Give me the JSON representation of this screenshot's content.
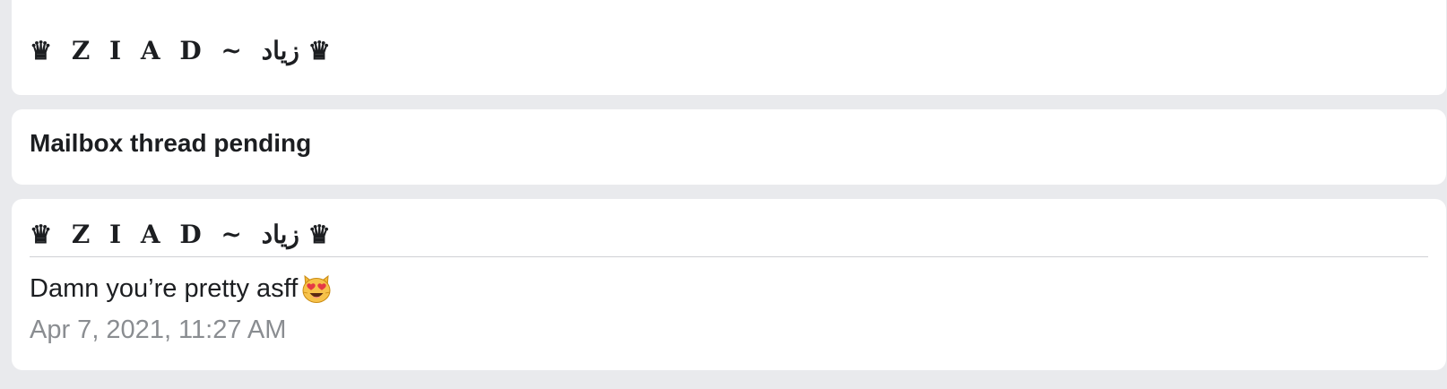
{
  "thread": {
    "top_sender": "♛ Z I A D ~ زياد ♛",
    "title": "Mailbox thread pending",
    "message": {
      "sender": "♛ Z I A D ~ زياد ♛",
      "text": "Damn you’re pretty asff",
      "emoji": "heart-eyes-cat-icon",
      "timestamp": "Apr 7, 2021, 11:27 AM"
    }
  },
  "colors": {
    "background": "#e9eaed",
    "card": "#ffffff",
    "text": "#1c1e21",
    "timestamp": "#8a8d91",
    "divider": "#cfd1d5"
  }
}
